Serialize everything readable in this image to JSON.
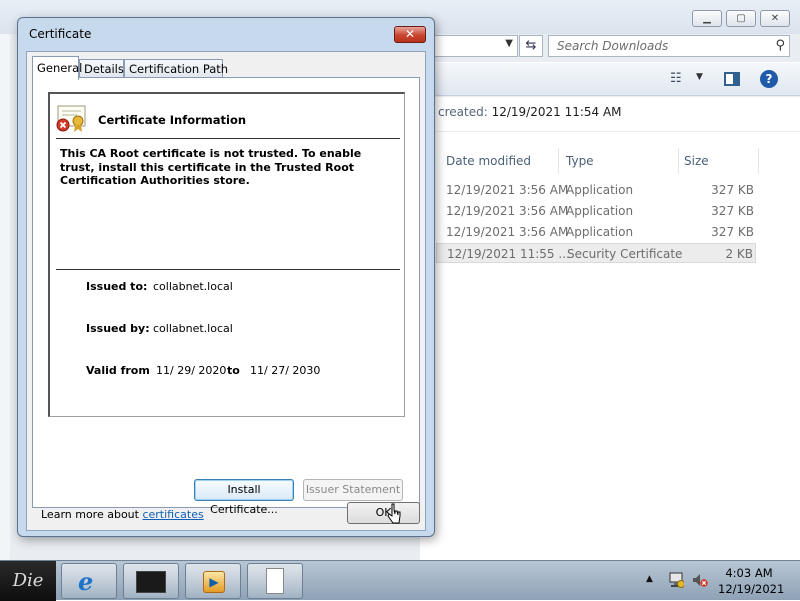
{
  "explorer": {
    "search_placeholder": "Search Downloads",
    "created_label": "created:",
    "created_value": "12/19/2021 11:54 AM",
    "columns": [
      "Date modified",
      "Type",
      "Size"
    ],
    "rows": [
      {
        "date": "12/19/2021 3:56 AM",
        "type": "Application",
        "size": "327 KB"
      },
      {
        "date": "12/19/2021 3:56 AM",
        "type": "Application",
        "size": "327 KB"
      },
      {
        "date": "12/19/2021 3:56 AM",
        "type": "Application",
        "size": "327 KB"
      },
      {
        "date": "12/19/2021 11:55 ...",
        "type": "Security Certificate",
        "size": "2 KB"
      }
    ]
  },
  "dialog": {
    "title": "Certificate",
    "tabs": [
      "General",
      "Details",
      "Certification Path"
    ],
    "info_heading": "Certificate Information",
    "trust_message": "This CA Root certificate is not trusted. To enable trust, install this certificate in the Trusted Root Certification Authorities store.",
    "issued_to_label": "Issued to:",
    "issued_to_value": "collabnet.local",
    "issued_by_label": "Issued by:",
    "issued_by_value": "collabnet.local",
    "valid_from_label": "Valid from",
    "valid_from_value": "11/ 29/ 2020",
    "valid_to_label": "to",
    "valid_to_value": "11/ 27/ 2030",
    "install_button": "Install Certificate...",
    "issuer_button": "Issuer Statement",
    "learn_more_text": "Learn more about",
    "learn_more_link": "certificates",
    "ok_button": "OK"
  },
  "taskbar": {
    "start_label": "Die",
    "clock_time": "4:03 AM",
    "clock_date": "12/19/2021"
  },
  "colors": {
    "dialog_frame": "#c7d9ec",
    "link": "#0f5fb8",
    "close_button": "#c94531"
  }
}
